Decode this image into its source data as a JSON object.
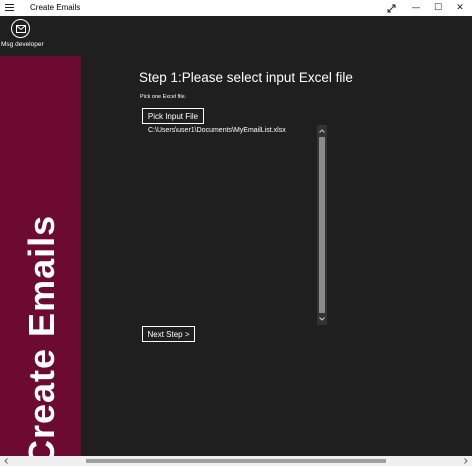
{
  "window": {
    "title": "Create Emails",
    "buttons": {
      "minimize": "—",
      "maximize": "☐",
      "close": "✕"
    }
  },
  "sidebar": {
    "developer_label": "Msg developer",
    "vertical_title": "Create Emails",
    "accent_color": "#6d0a31"
  },
  "main": {
    "heading": "Step 1:Please select input Excel file",
    "subtext": "Pick one Excel file.",
    "pick_button_label": "Pick Input File",
    "files": [
      "C:\\Users\\user1\\Documents\\MyEmailList.xlsx"
    ],
    "next_button_label": "Next Step >"
  },
  "icons": {
    "menu": "hamburger-icon",
    "expand": "expand-icon",
    "mail": "mail-icon",
    "capture_tools": [
      "clip-icon",
      "screen-icon",
      "capture-icon",
      "share-icon"
    ]
  }
}
